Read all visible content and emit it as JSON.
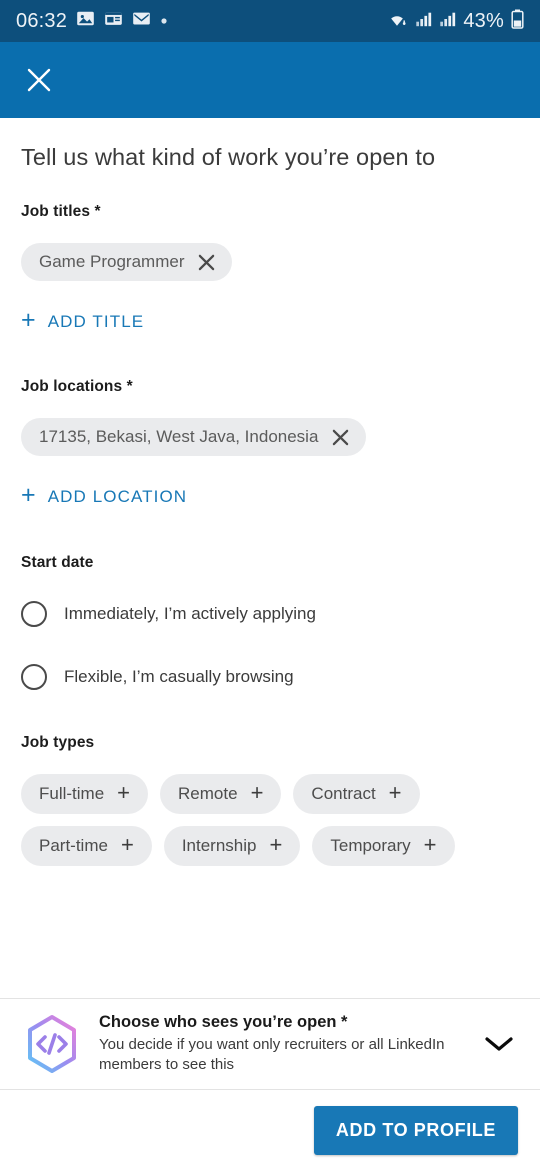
{
  "status_bar": {
    "time": "06:32",
    "battery_percent": "43%",
    "icons": [
      "photos-icon",
      "news-icon",
      "gmail-icon",
      "dot-icon",
      "wifi-icon",
      "signal-icon",
      "signal-icon",
      "battery-icon"
    ]
  },
  "app_bar": {
    "close_label": "✕"
  },
  "page": {
    "title": "Tell us what kind of work you’re open to"
  },
  "job_titles": {
    "label": "Job titles *",
    "chips": [
      {
        "text": "Game Programmer"
      }
    ],
    "add_label": "ADD TITLE",
    "add_plus": "+"
  },
  "job_locations": {
    "label": "Job locations *",
    "chips": [
      {
        "text": "17135, Bekasi, West Java, Indonesia"
      }
    ],
    "add_label": "ADD LOCATION",
    "add_plus": "+"
  },
  "start_date": {
    "label": "Start date",
    "options": [
      {
        "label": "Immediately, I’m actively applying",
        "selected": false
      },
      {
        "label": "Flexible, I’m casually browsing",
        "selected": false
      }
    ]
  },
  "job_types": {
    "label": "Job types",
    "plus": "+",
    "chips": [
      {
        "label": "Full-time"
      },
      {
        "label": "Remote"
      },
      {
        "label": "Contract"
      },
      {
        "label": "Part-time"
      },
      {
        "label": "Internship"
      },
      {
        "label": "Temporary"
      }
    ]
  },
  "visibility_card": {
    "title": "Choose who sees you’re open *",
    "description": "You decide if you want only recruiters or all LinkedIn members to see this",
    "icon": "code-hexagon-icon",
    "expand_icon": "chevron-down-icon"
  },
  "bottom_bar": {
    "primary_label": "ADD TO PROFILE"
  },
  "colors": {
    "status_bar": "#0d4f7c",
    "app_bar": "#0a6eae",
    "accent_blue": "#1878b6",
    "chip_bg": "#eaebed",
    "text_primary": "#1c1c1c"
  }
}
